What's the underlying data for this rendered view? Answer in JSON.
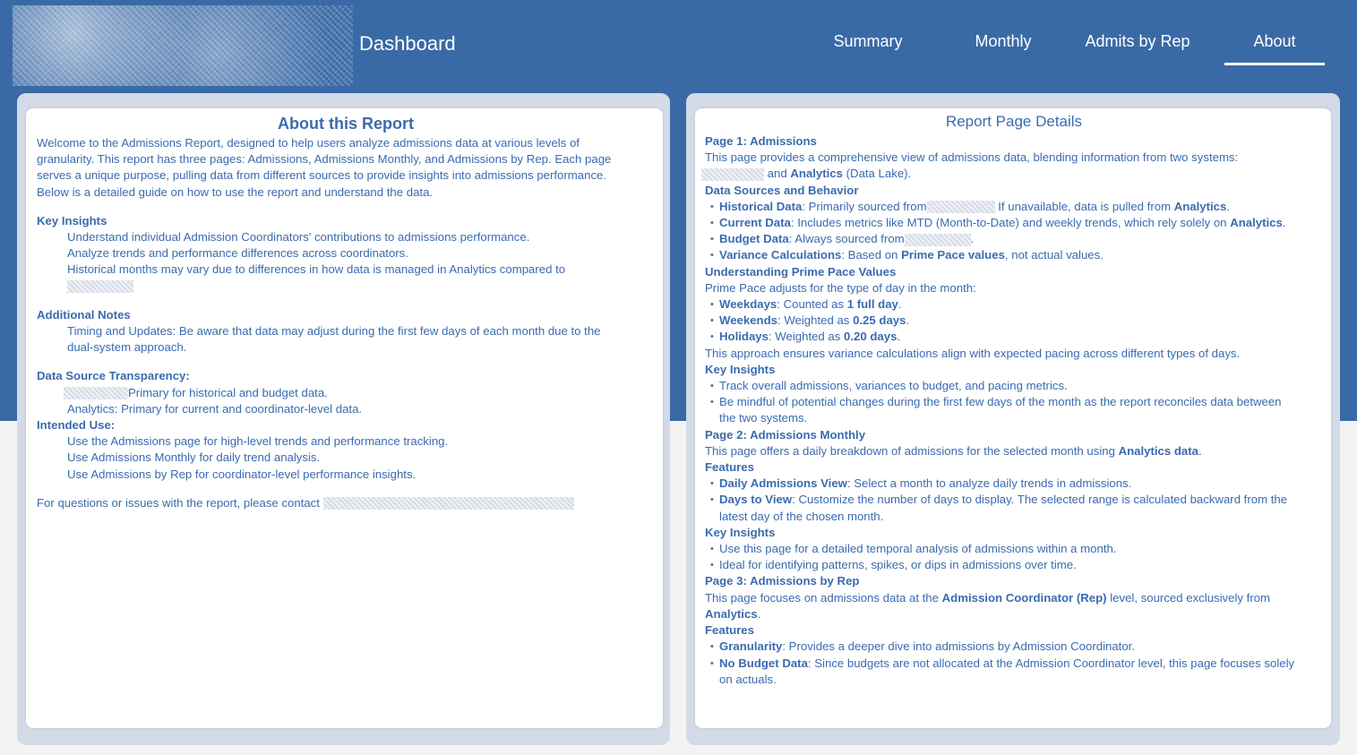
{
  "header": {
    "title": "Dashboard",
    "nav": [
      "Summary",
      "Monthly",
      "Admits by Rep",
      "About"
    ],
    "active_tab": "About"
  },
  "left": {
    "title": "About this Report",
    "intro": [
      "Welcome to the Admissions Report, designed to help users analyze admissions data at various levels of",
      "granularity. This report has three pages: Admissions, Admissions Monthly, and Admissions by Rep. Each page",
      "serves a unique purpose, pulling data from different sources to provide insights into admissions performance.",
      "Below is a detailed guide on how to use the report and understand the data."
    ],
    "key_insights_heading": "Key Insights",
    "key_insights": [
      "Understand individual Admission Coordinators' contributions to admissions performance.",
      "Analyze trends and performance differences across coordinators.",
      "Historical months may vary due to differences in how data is managed in Analytics compared to"
    ],
    "additional_notes_heading": "Additional Notes",
    "additional_notes": [
      "Timing and Updates: Be aware that data may adjust during the first few days of each month due to the",
      "dual-system approach."
    ],
    "transparency_heading": "Data Source Transparency:",
    "transparency": [
      "Primary for historical and budget data.",
      "Analytics: Primary for current and coordinator-level data."
    ],
    "intended_heading": "Intended Use:",
    "intended": [
      "Use the Admissions page for high-level trends and performance tracking.",
      "Use Admissions Monthly for daily trend analysis.",
      "Use Admissions by Rep for coordinator-level performance insights."
    ],
    "contact": "For questions or issues with the report, please contact"
  },
  "right": {
    "title": "Report Page Details",
    "page1_heading": "Page 1: Admissions",
    "page1_intro": "This page provides a comprehensive view of admissions data, blending information from two systems:",
    "page1_intro2_a": " and ",
    "page1_intro2_b": "Analytics",
    "page1_intro2_c": " (Data Lake).",
    "ds_heading": "Data Sources and Behavior",
    "ds_hist_label": "Historical Data",
    "ds_hist_a": ": Primarily sourced from",
    "ds_hist_b": " If unavailable, data is pulled from ",
    "ds_hist_c": "Analytics",
    "ds_hist_d": ".",
    "ds_cur_label": "Current Data",
    "ds_cur_a": ": Includes metrics like MTD (Month-to-Date) and weekly trends, which rely solely on ",
    "ds_cur_b": "Analytics",
    "ds_cur_c": ".",
    "ds_bud_label": "Budget Data",
    "ds_bud_a": ": Always sourced from",
    "ds_bud_b": ".",
    "ds_var_label": "Variance Calculations",
    "ds_var_a": ": Based on ",
    "ds_var_b": "Prime Pace values",
    "ds_var_c": ", not actual values.",
    "pp_heading": "Understanding Prime Pace Values",
    "pp_intro": "Prime Pace adjusts for the type of day in the month:",
    "pp_wd_label": "Weekdays",
    "pp_wd_a": ": Counted as ",
    "pp_wd_b": "1 full day",
    "pp_wd_c": ".",
    "pp_we_label": "Weekends",
    "pp_we_a": ": Weighted as ",
    "pp_we_b": "0.25 days",
    "pp_we_c": ".",
    "pp_ho_label": "Holidays",
    "pp_ho_a": ": Weighted as ",
    "pp_ho_b": "0.20 days",
    "pp_ho_c": ".",
    "pp_outro": "This approach ensures variance calculations align with expected pacing across different types of days.",
    "ki1_heading": "Key Insights",
    "ki1_a": "Track overall admissions, variances to budget, and pacing metrics.",
    "ki1_b1": "Be mindful of potential changes during the first few days of the month as the report reconciles data between",
    "ki1_b2": "the two systems.",
    "page2_heading": "Page 2: Admissions Monthly",
    "page2_a": "This page offers a daily breakdown of admissions for the selected month using ",
    "page2_b": "Analytics data",
    "page2_c": ".",
    "f2_heading": "Features",
    "f2_dav_label": "Daily Admissions View",
    "f2_dav_a": ": Select a month to analyze daily trends in admissions.",
    "f2_dtv_label": "Days to View",
    "f2_dtv_a": ": Customize the number of days to display. The selected range is calculated backward from the",
    "f2_dtv_b": "latest day of the chosen month.",
    "ki2_heading": "Key Insights",
    "ki2_a": "Use this page for a detailed temporal analysis of admissions within a month.",
    "ki2_b": "Ideal for identifying patterns, spikes, or dips in admissions over time.",
    "page3_heading": "Page 3: Admissions by Rep",
    "page3_a": "This page focuses on admissions data at the ",
    "page3_b": "Admission Coordinator (Rep)",
    "page3_c": " level, sourced exclusively from",
    "page3_d": "Analytics",
    "page3_e": ".",
    "f3_heading": "Features",
    "f3_gr_label": "Granularity",
    "f3_gr_a": ": Provides a deeper dive into admissions by Admission Coordinator.",
    "f3_nb_label": "No Budget Data",
    "f3_nb_a": ": Since budgets are not allocated at the Admission Coordinator level, this page focuses solely",
    "f3_nb_b": "on actuals."
  }
}
